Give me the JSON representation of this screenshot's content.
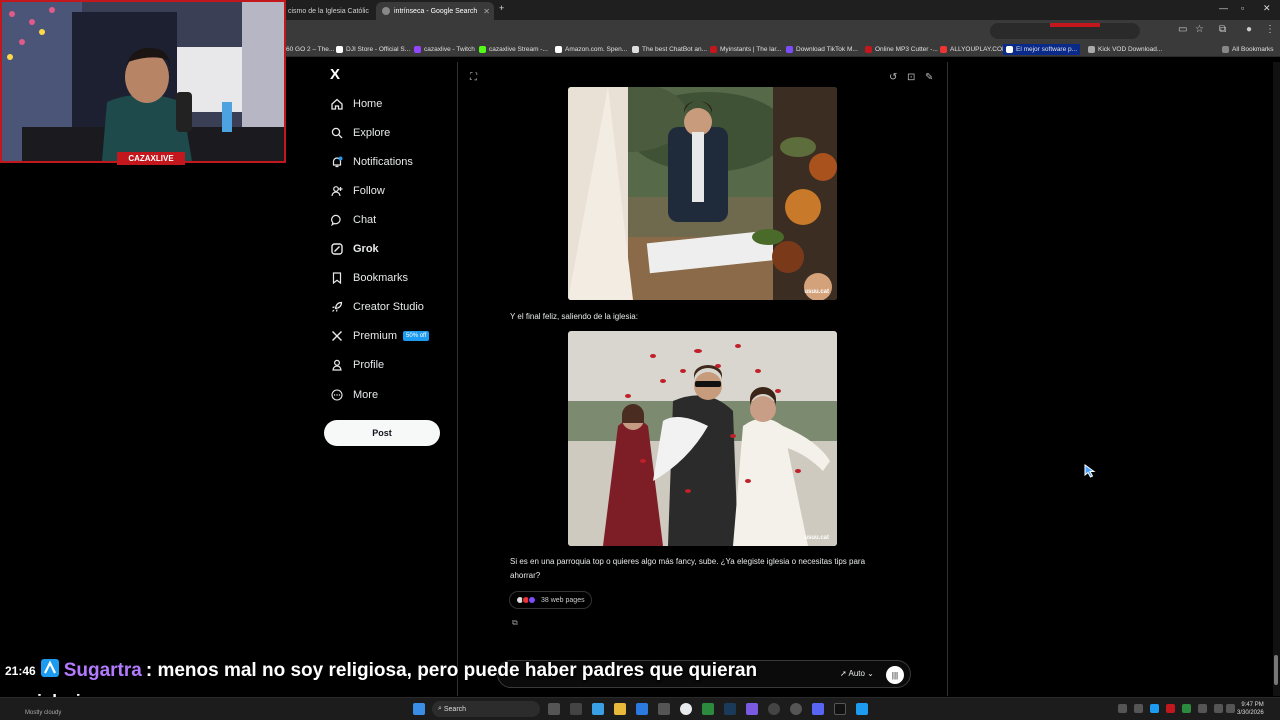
{
  "browser": {
    "tabs": [
      {
        "label": "cismo de la Iglesia Católic",
        "active": false
      },
      {
        "label": "intrínseca - Google Search",
        "active": true
      }
    ],
    "bookmarks": [
      "60 GO 2 – The...",
      "DJI Store - Official S...",
      "cazaxlive - Twitch",
      "cazaxlive Stream -...",
      "Amazon.com. Spen...",
      "The best ChatBot an...",
      "Myinstants | The lar...",
      "Download TikTok M...",
      "Online MP3 Cutter -...",
      "ALLYOUPLAY.COM -...",
      "El mejor software p...",
      "Kick VOD Download...",
      "All Bookmarks"
    ]
  },
  "sidebar": {
    "logo": "X",
    "items": [
      {
        "label": "Home",
        "icon": "home-icon",
        "bold": false
      },
      {
        "label": "Explore",
        "icon": "search-icon",
        "bold": false
      },
      {
        "label": "Notifications",
        "icon": "bell-icon",
        "bold": false
      },
      {
        "label": "Follow",
        "icon": "person-add-icon",
        "bold": false
      },
      {
        "label": "Chat",
        "icon": "chat-icon",
        "bold": false
      },
      {
        "label": "Grok",
        "icon": "grok-icon",
        "bold": true
      },
      {
        "label": "Bookmarks",
        "icon": "bookmark-icon",
        "bold": false
      },
      {
        "label": "Creator Studio",
        "icon": "rocket-icon",
        "bold": false
      },
      {
        "label": "Premium",
        "icon": "x-icon",
        "bold": false,
        "badge": "50% off"
      },
      {
        "label": "Profile",
        "icon": "person-icon",
        "bold": false
      },
      {
        "label": "More",
        "icon": "more-icon",
        "bold": false
      }
    ],
    "post_label": "Post"
  },
  "grok": {
    "image1_watermark": "usuu.cat",
    "caption": "Y el final feliz, saliendo de la iglesia:",
    "image2_watermark": "usuu.cat",
    "reply": "Si es en una parroquia top o quieres algo más fancy, sube. ¿Ya elegiste iglesia o necesitas tips para ahorrar?",
    "web_pages": "38 web pages",
    "mode_label": "Auto"
  },
  "webcam": {
    "label": "CAZAXLIVE"
  },
  "chat_overlay": {
    "time": "21:46",
    "user": "Sugartra",
    "line1": ": menos mal no soy religiosa, pero puede haber padres que quieran",
    "line2": "por iglesia"
  },
  "taskbar": {
    "search": "Search",
    "weather": "Mostly cloudy",
    "time": "9:47 PM",
    "date": "3/30/2026"
  },
  "colors": {
    "accent_red": "#c3171e",
    "x_blue": "#1d9bf0",
    "chat_user": "#b37aff"
  }
}
